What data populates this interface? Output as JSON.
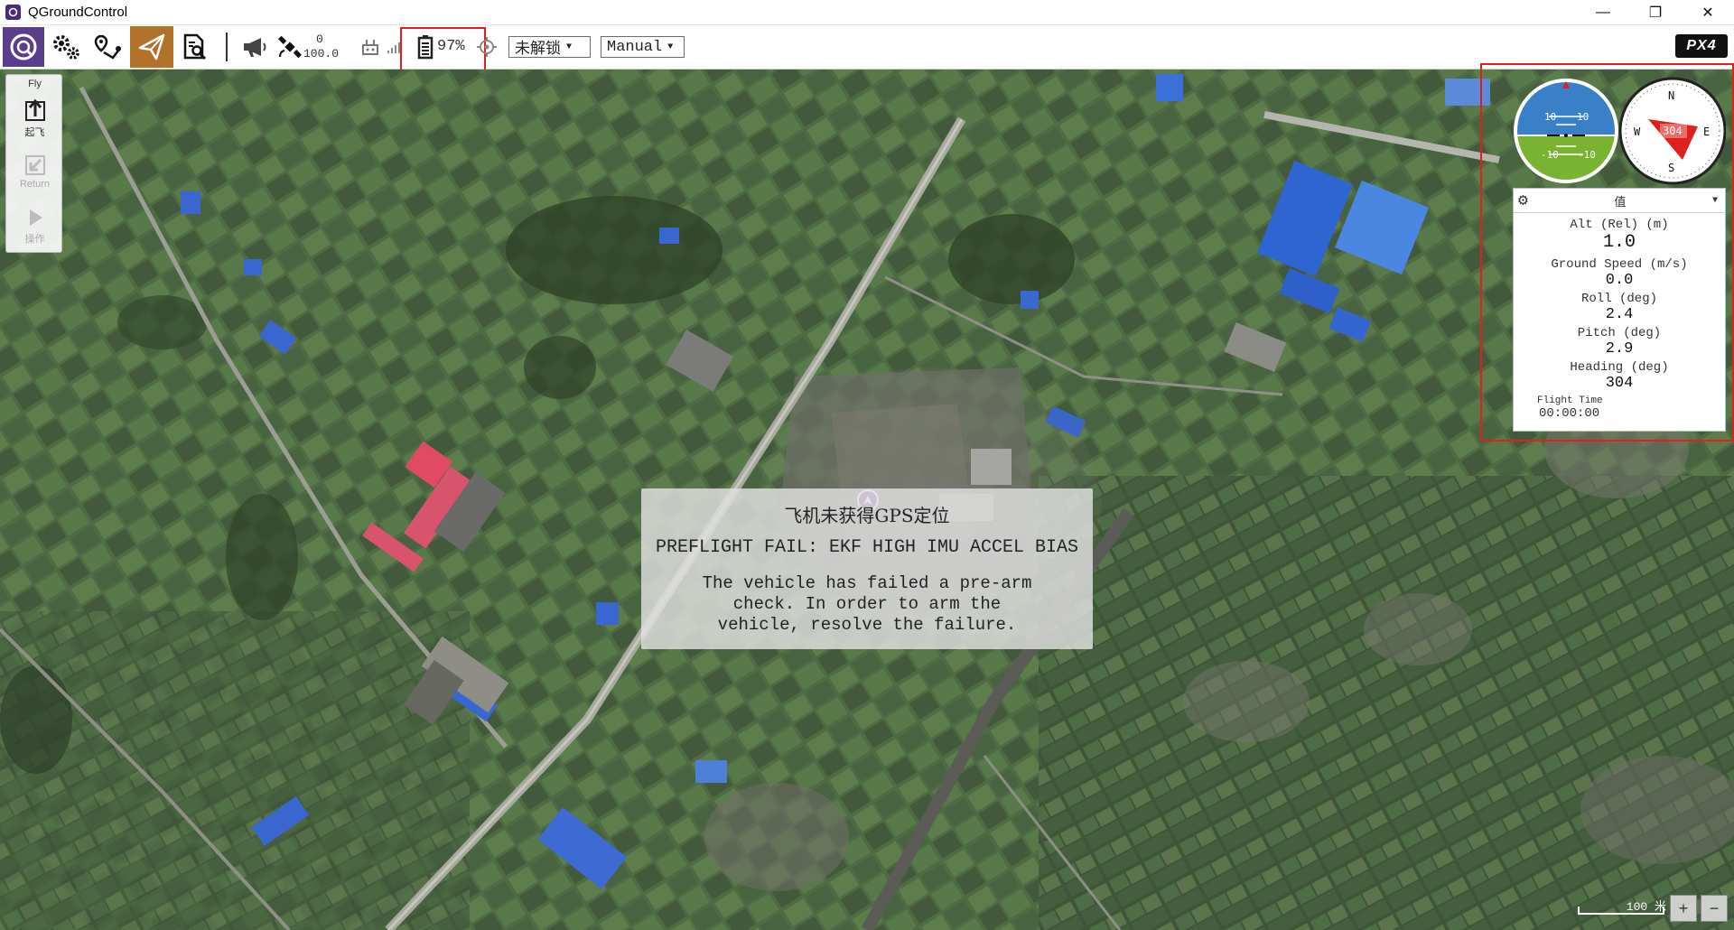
{
  "window": {
    "title": "QGroundControl",
    "controls": [
      "—",
      "❐",
      "✕"
    ]
  },
  "toolbar": {
    "rc_signal_value": "0",
    "rc_rssi_value": "100.0",
    "battery_percent": "97%",
    "arm_state": "未解锁",
    "flight_mode": "Manual",
    "logo_text": "PX4"
  },
  "toolstrip": {
    "header": "Fly",
    "takeoff_label": "起飞",
    "return_label": "Return",
    "action_label": "操作"
  },
  "instrument": {
    "attitude_ticks": [
      "10",
      "10",
      "-10",
      "-10"
    ],
    "compass": {
      "n": "N",
      "s": "S",
      "e": "E",
      "w": "W",
      "heading": "304"
    }
  },
  "values_panel": {
    "header": "值",
    "alt_label": "Alt (Rel) (m)",
    "alt_value": "1.0",
    "speed_label": "Ground Speed (m/s)",
    "speed_value": "0.0",
    "roll_label": "Roll (deg)",
    "roll_value": "2.4",
    "pitch_label": "Pitch (deg)",
    "pitch_value": "2.9",
    "heading_label": "Heading (deg)",
    "heading_value": "304",
    "flight_time_label": "Flight Time",
    "flight_time_value": "00:00:00"
  },
  "message": {
    "title": "飞机未获得GPS定位",
    "headline": "PREFLIGHT FAIL: EKF HIGH IMU ACCEL BIAS",
    "line1": "The vehicle has failed a pre-arm",
    "line2": "check. In order to arm the",
    "line3": "vehicle, resolve the failure."
  },
  "map_scale": {
    "label": "100 米",
    "zoom_in": "+",
    "zoom_out": "−"
  },
  "colors": {
    "accent": "#b3722a",
    "highlight_red": "#e0201b",
    "sky": "#3a80c8",
    "ground": "#7ab331"
  }
}
